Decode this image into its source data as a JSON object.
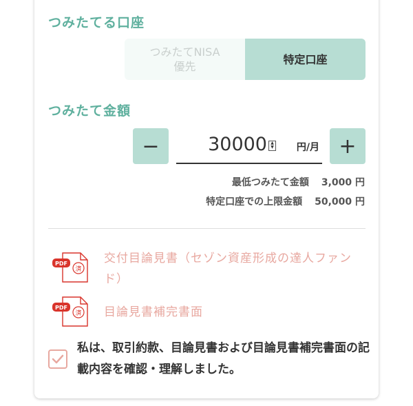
{
  "account": {
    "title": "つみたてる口座",
    "options": [
      {
        "label": "つみたてNISA\n優先",
        "selected": false
      },
      {
        "label": "特定口座",
        "selected": true
      }
    ]
  },
  "amount": {
    "title": "つみたて金額",
    "value": "30000",
    "unit": "円/月",
    "minus_label": "−",
    "plus_label": "+",
    "spin_up": "▲",
    "spin_down": "▼"
  },
  "limits": {
    "min_label": "最低つみたて金額",
    "min_value": "3,000 円",
    "max_label": "特定口座での上限金額",
    "max_value": "50,000 円"
  },
  "documents": [
    {
      "label": "交付目論見書（セゾン資産形成の達人ファンド）",
      "icon": "pdf-icon",
      "badge": "PDF",
      "stamp": "済"
    },
    {
      "label": "目論見書補完書面",
      "icon": "pdf-icon",
      "badge": "PDF",
      "stamp": "済"
    }
  ],
  "consent": {
    "checked": true,
    "text": "私は、取引約款、目論見書および目論見書補完書面の記載内容を確認・理解しました。"
  },
  "colors": {
    "accent_teal": "#5fb09e",
    "button_teal": "#b7ddd3",
    "link_pink": "#e8a8a0",
    "pdf_red": "#d9342b"
  }
}
